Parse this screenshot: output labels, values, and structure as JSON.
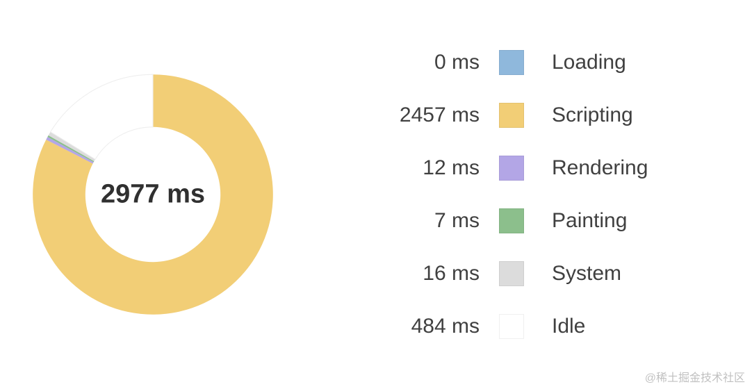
{
  "chart_data": {
    "type": "pie",
    "title": "",
    "total_label": "2977 ms",
    "unit": "ms",
    "series": [
      {
        "name": "Loading",
        "value": 0,
        "color": "#8fb8dc"
      },
      {
        "name": "Scripting",
        "value": 2457,
        "color": "#f2ce76"
      },
      {
        "name": "Rendering",
        "value": 12,
        "color": "#b3a6e6"
      },
      {
        "name": "Painting",
        "value": 7,
        "color": "#8cbf8c"
      },
      {
        "name": "System",
        "value": 16,
        "color": "#dcdcdc"
      },
      {
        "name": "Idle",
        "value": 484,
        "color": "#ffffff"
      }
    ]
  },
  "legend": {
    "items": [
      {
        "value_label": "0 ms",
        "label": "Loading",
        "color": "#8fb8dc"
      },
      {
        "value_label": "2457 ms",
        "label": "Scripting",
        "color": "#f2ce76"
      },
      {
        "value_label": "12 ms",
        "label": "Rendering",
        "color": "#b3a6e6"
      },
      {
        "value_label": "7 ms",
        "label": "Painting",
        "color": "#8cbf8c"
      },
      {
        "value_label": "16 ms",
        "label": "System",
        "color": "#dcdcdc"
      },
      {
        "value_label": "484 ms",
        "label": "Idle",
        "color": "#ffffff"
      }
    ]
  },
  "watermark": "@稀土掘金技术社区"
}
